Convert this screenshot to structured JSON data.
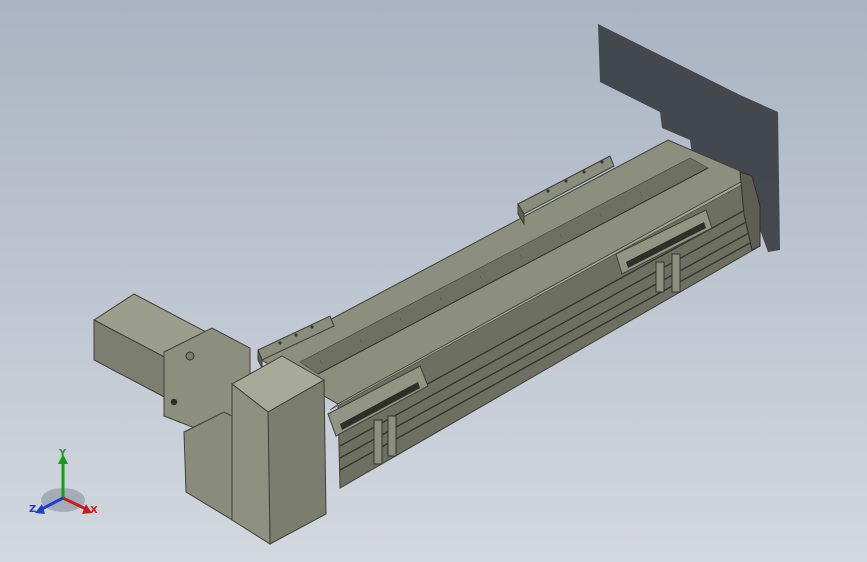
{
  "view": {
    "description_free": true,
    "colors": {
      "background_top": "#aab4c2",
      "background_bottom": "#d3d8df",
      "body": "#7d7f70",
      "body_light": "#9a9c8c",
      "body_dark": "#4f5146",
      "shadow": "#3a3e44",
      "axis_x": "#c81e1e",
      "axis_y": "#1a9a1a",
      "axis_z": "#1e3fc8"
    }
  },
  "triad": {
    "x_label": "X",
    "y_label": "Y",
    "z_label": "Z",
    "x_icon": "x-axis-arrow-icon",
    "y_icon": "y-axis-arrow-icon",
    "z_icon": "z-axis-arrow-icon"
  }
}
